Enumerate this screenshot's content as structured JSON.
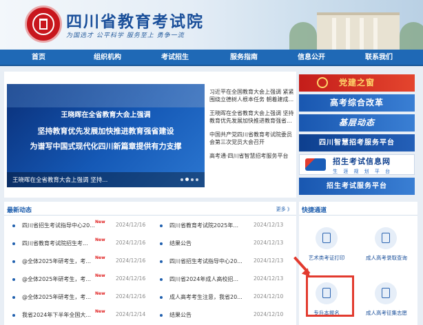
{
  "header": {
    "site_title": "四川省教育考试院",
    "motto": "为国选才  公平科学  服务至上  勇争一流"
  },
  "nav": [
    "首页",
    "组织机构",
    "考试招生",
    "服务指南",
    "信息公开",
    "联系我们"
  ],
  "slideshow": {
    "headline": "王晓晖在全省教育大会上强调",
    "line1": "坚持教育优先发展加快推进教育强省建设",
    "line2": "为谱写中国式现代化四川新篇章提供有力支撑",
    "caption": "王晓晖在全省教育大会上强调 坚持..."
  },
  "top_news": [
    "习近平在全国教育大会上强调 紧紧围绕立德树人根本任务 朝着建成...",
    "王晓晖在全省教育大会上强调 坚持教育优先发展加快推进教育强省...",
    "中国共产党四川省教育考试院委员会第三次党员大会召开",
    "高考通·四川省智慧招考服务平台"
  ],
  "banners": {
    "party": "党建之窗",
    "reform": "高考综合改革",
    "base": "基层动态",
    "smart": "四川智慧招考服务平台",
    "info_title": "招生考试信息网",
    "info_sub": "生 涯 规 划 平 台",
    "platform": "招生考试服务平台"
  },
  "latest": {
    "title": "最新动态",
    "more": "更多 》",
    "new_badge": "New",
    "left": [
      {
        "title": "四川省招生考试指导中心20...",
        "date": "2024/12/16",
        "is_new": true
      },
      {
        "title": "四川省教育考试院招生考...",
        "date": "2024/12/16",
        "is_new": true
      },
      {
        "title": "@全体2025年研考生，考...",
        "date": "2024/12/16",
        "is_new": true
      },
      {
        "title": "@全体2025年研考生，考...",
        "date": "2024/12/16",
        "is_new": true
      },
      {
        "title": "@全体2025年研考生，考...",
        "date": "2024/12/16",
        "is_new": true
      },
      {
        "title": "我省2024年下半年全国大...",
        "date": "2024/12/14",
        "is_new": true
      }
    ],
    "right": [
      {
        "title": "四川省教育考试院2025年...",
        "date": "2024/12/13"
      },
      {
        "title": "结果公告",
        "date": "2024/12/13"
      },
      {
        "title": "四川省招生考试指导中心20...",
        "date": "2024/12/13"
      },
      {
        "title": "四川省2024年成人高校招...",
        "date": "2024/12/13"
      },
      {
        "title": "成人高考考生注意，我省20...",
        "date": "2024/12/10"
      },
      {
        "title": "结果公告",
        "date": "2024/12/10"
      }
    ]
  },
  "quick": {
    "title": "快捷通道",
    "items": [
      {
        "label": "艺术类考证打印",
        "icon": "document-icon"
      },
      {
        "label": "成人高考录取查询",
        "icon": "edit-icon"
      },
      {
        "label": "专升本报名",
        "icon": "edit-icon"
      },
      {
        "label": "成人高考征集志愿",
        "icon": "list-document-icon"
      }
    ]
  },
  "colors": {
    "nav": "#1f69b6",
    "accent": "#1f5fae",
    "highlight": "#e23a2e",
    "new": "#e02020"
  }
}
